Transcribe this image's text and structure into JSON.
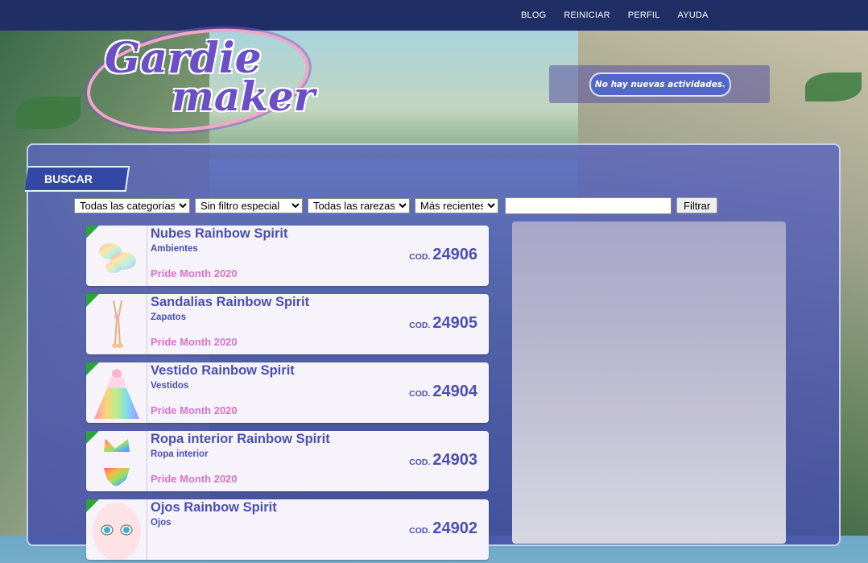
{
  "nav": {
    "items": [
      "BLOG",
      "REINICIAR",
      "PERFIL",
      "AYUDA"
    ]
  },
  "logo": {
    "line1": "Gardie",
    "line2": "maker"
  },
  "activity": {
    "text": "No hay nuevas actividades."
  },
  "search": {
    "tab_label": "BUSCAR"
  },
  "filters": {
    "category": "Todas las categorías",
    "special": "Sin filtro especial",
    "rarity": "Todas las rarezas",
    "sort": "Más recientes",
    "text_value": "",
    "button": "Filtrar"
  },
  "items": [
    {
      "name": "Nubes Rainbow Spirit",
      "category": "Ambientes",
      "event": "Pride Month 2020",
      "code_label": "COD.",
      "code": "24906",
      "icon": "clouds-icon"
    },
    {
      "name": "Sandalias Rainbow Spirit",
      "category": "Zapatos",
      "event": "Pride Month 2020",
      "code_label": "COD.",
      "code": "24905",
      "icon": "sandals-icon"
    },
    {
      "name": "Vestido Rainbow Spirit",
      "category": "Vestidos",
      "event": "Pride Month 2020",
      "code_label": "COD.",
      "code": "24904",
      "icon": "dress-icon"
    },
    {
      "name": "Ropa interior Rainbow Spirit",
      "category": "Ropa interior",
      "event": "Pride Month 2020",
      "code_label": "COD.",
      "code": "24903",
      "icon": "underwear-icon"
    },
    {
      "name": "Ojos Rainbow Spirit",
      "category": "Ojos",
      "event": "",
      "code_label": "COD.",
      "code": "24902",
      "icon": "eyes-icon"
    }
  ],
  "colors": {
    "nav_bg": "#1f2f66",
    "accent": "#4a4fb0",
    "event": "#d774c9",
    "new_badge": "#2aa53a"
  }
}
